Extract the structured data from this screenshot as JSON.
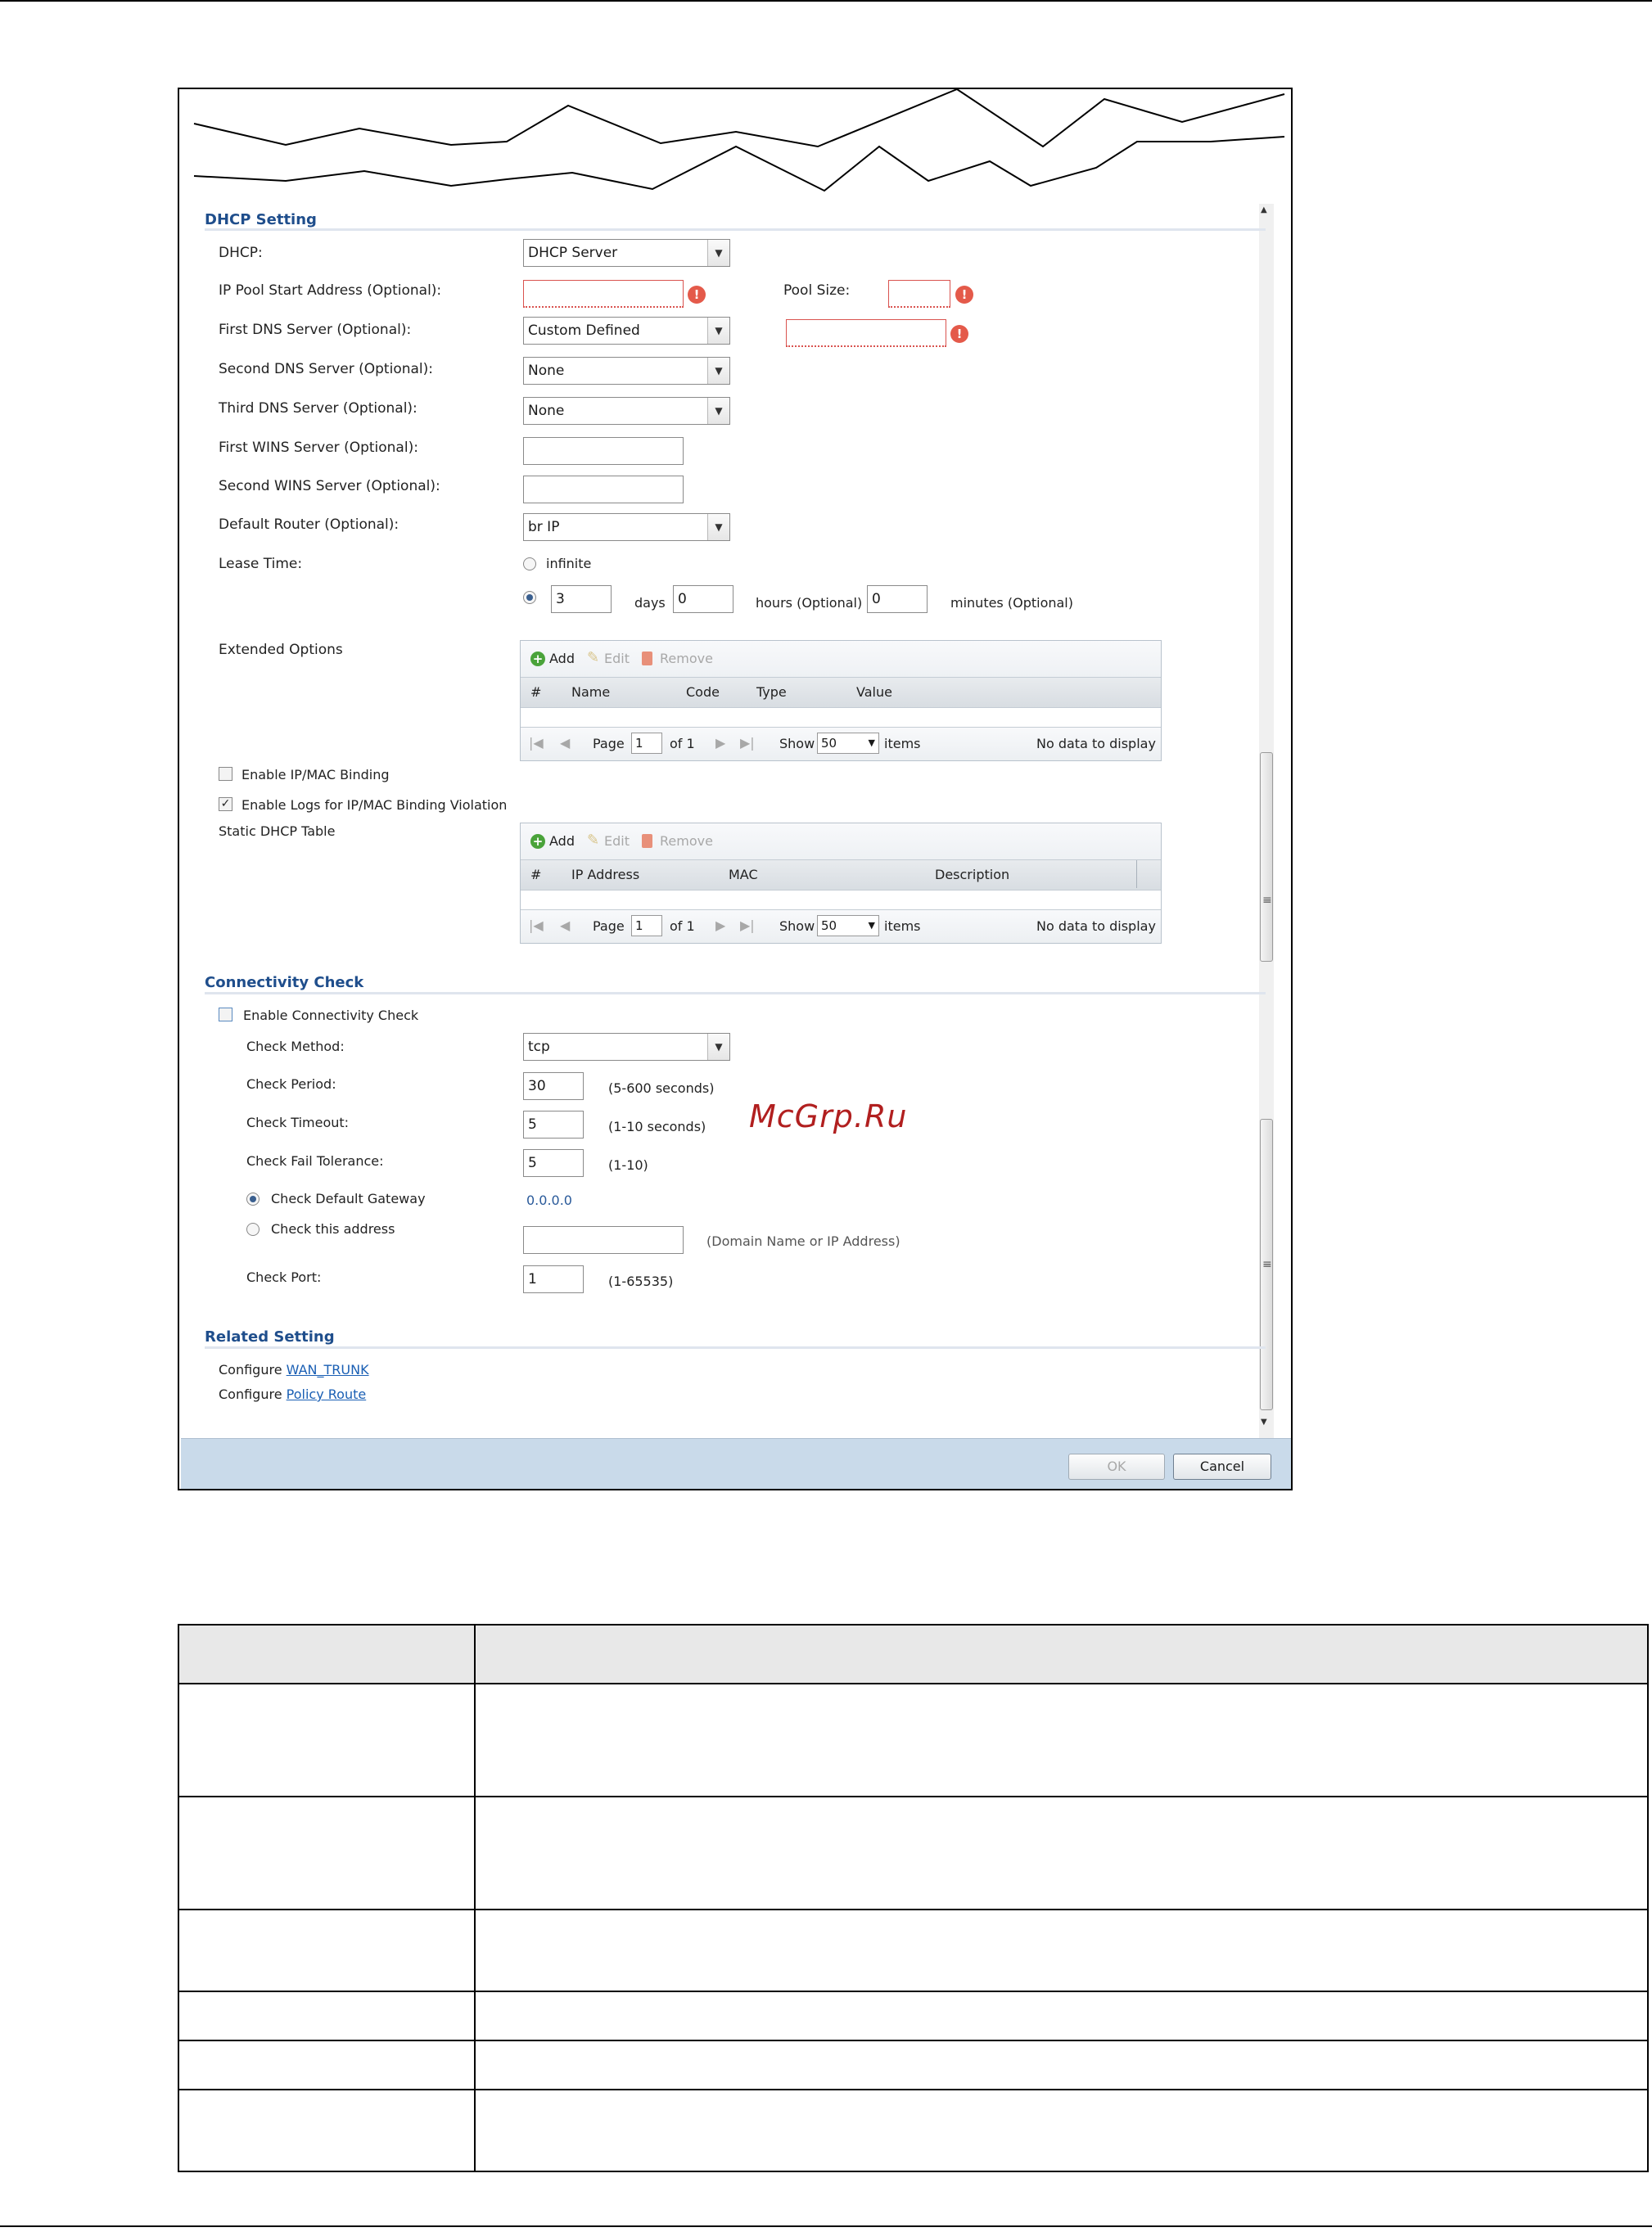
{
  "dhcp": {
    "section_title": "DHCP Setting",
    "dhcp_label": "DHCP:",
    "dhcp_value": "DHCP Server",
    "pool_start_label": "IP Pool Start Address (Optional):",
    "pool_start_value": "",
    "pool_size_label": "Pool Size:",
    "pool_size_value": "",
    "dns1_label": "First DNS Server (Optional):",
    "dns1_value": "Custom Defined",
    "dns1_custom_value": "",
    "dns2_label": "Second DNS Server (Optional):",
    "dns2_value": "None",
    "dns3_label": "Third DNS Server (Optional):",
    "dns3_value": "None",
    "wins1_label": "First WINS Server (Optional):",
    "wins1_value": "",
    "wins2_label": "Second WINS Server (Optional):",
    "wins2_value": "",
    "router_label": "Default Router (Optional):",
    "router_value": "br IP",
    "lease_label": "Lease Time:",
    "lease_infinite": "infinite",
    "lease_days_value": "3",
    "lease_days_unit": "days",
    "lease_hours_value": "0",
    "lease_hours_unit": "hours (Optional)",
    "lease_minutes_value": "0",
    "lease_minutes_unit": "minutes (Optional)",
    "ext_label": "Extended Options",
    "ipmac_label": "Enable IP/MAC Binding",
    "ipmac_logs_label": "Enable Logs for IP/MAC Binding Violation",
    "static_label": "Static DHCP Table"
  },
  "grid_common": {
    "add": "Add",
    "edit": "Edit",
    "remove": "Remove",
    "page": "Page",
    "page_value": "1",
    "of": "of 1",
    "show": "Show",
    "show_value": "50",
    "items": "items",
    "no_data": "No data to display"
  },
  "ext_grid": {
    "columns": [
      "#",
      "Name",
      "Code",
      "Type",
      "Value"
    ]
  },
  "static_grid": {
    "columns": [
      "#",
      "IP Address",
      "MAC",
      "Description"
    ]
  },
  "conn": {
    "section_title": "Connectivity Check",
    "enable_label": "Enable Connectivity Check",
    "method_label": "Check Method:",
    "method_value": "tcp",
    "period_label": "Check Period:",
    "period_value": "30",
    "period_hint": "(5-600 seconds)",
    "timeout_label": "Check Timeout:",
    "timeout_value": "5",
    "timeout_hint": "(1-10 seconds)",
    "fail_label": "Check Fail Tolerance:",
    "fail_value": "5",
    "fail_hint": "(1-10)",
    "default_gw_label": "Check Default Gateway",
    "default_gw_value": "0.0.0.0",
    "address_label": "Check this address",
    "address_value": "",
    "address_hint": "(Domain Name or IP Address)",
    "port_label": "Check Port:",
    "port_value": "1",
    "port_hint": "(1-65535)"
  },
  "related": {
    "section_title": "Related Setting",
    "configure": "Configure",
    "wan_link": "WAN_TRUNK",
    "policy_link": "Policy Route"
  },
  "footer": {
    "ok": "OK",
    "cancel": "Cancel"
  },
  "watermark": "McGrp.Ru",
  "colors": {
    "section_title": "#1f4e8c",
    "link": "#1a5fb4",
    "footer_bar": "#c9daea",
    "error": "#e45a4a"
  }
}
